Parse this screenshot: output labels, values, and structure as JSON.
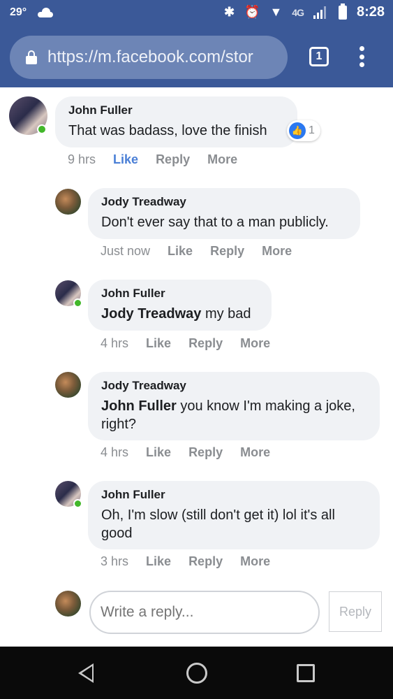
{
  "status_bar": {
    "temperature": "29°",
    "network": "4G",
    "time": "8:28"
  },
  "browser": {
    "url": "https://m.facebook.com/stor",
    "tab_count": "1"
  },
  "comments": [
    {
      "author": "John Fuller",
      "text": "That was badass, love the finish",
      "time": "9 hrs",
      "like_label": "Like",
      "reply_label": "Reply",
      "more_label": "More",
      "like_count": "1",
      "online": true,
      "liked": true
    },
    {
      "author": "Jody Treadway",
      "text": "Don't ever say that to a man publicly.",
      "time": "Just now",
      "like_label": "Like",
      "reply_label": "Reply",
      "more_label": "More",
      "online": false
    },
    {
      "author": "John Fuller",
      "mention": "Jody Treadway",
      "text": " my bad",
      "time": "4 hrs",
      "like_label": "Like",
      "reply_label": "Reply",
      "more_label": "More",
      "online": true
    },
    {
      "author": "Jody Treadway",
      "mention": "John Fuller",
      "text": " you know I'm making a joke, right?",
      "time": "4 hrs",
      "like_label": "Like",
      "reply_label": "Reply",
      "more_label": "More",
      "online": false
    },
    {
      "author": "John Fuller",
      "text": "Oh, I'm slow (still don't get it) lol it's all good",
      "time": "3 hrs",
      "like_label": "Like",
      "reply_label": "Reply",
      "more_label": "More",
      "online": true
    }
  ],
  "reply_box": {
    "placeholder": "Write a reply...",
    "button_label": "Reply"
  }
}
